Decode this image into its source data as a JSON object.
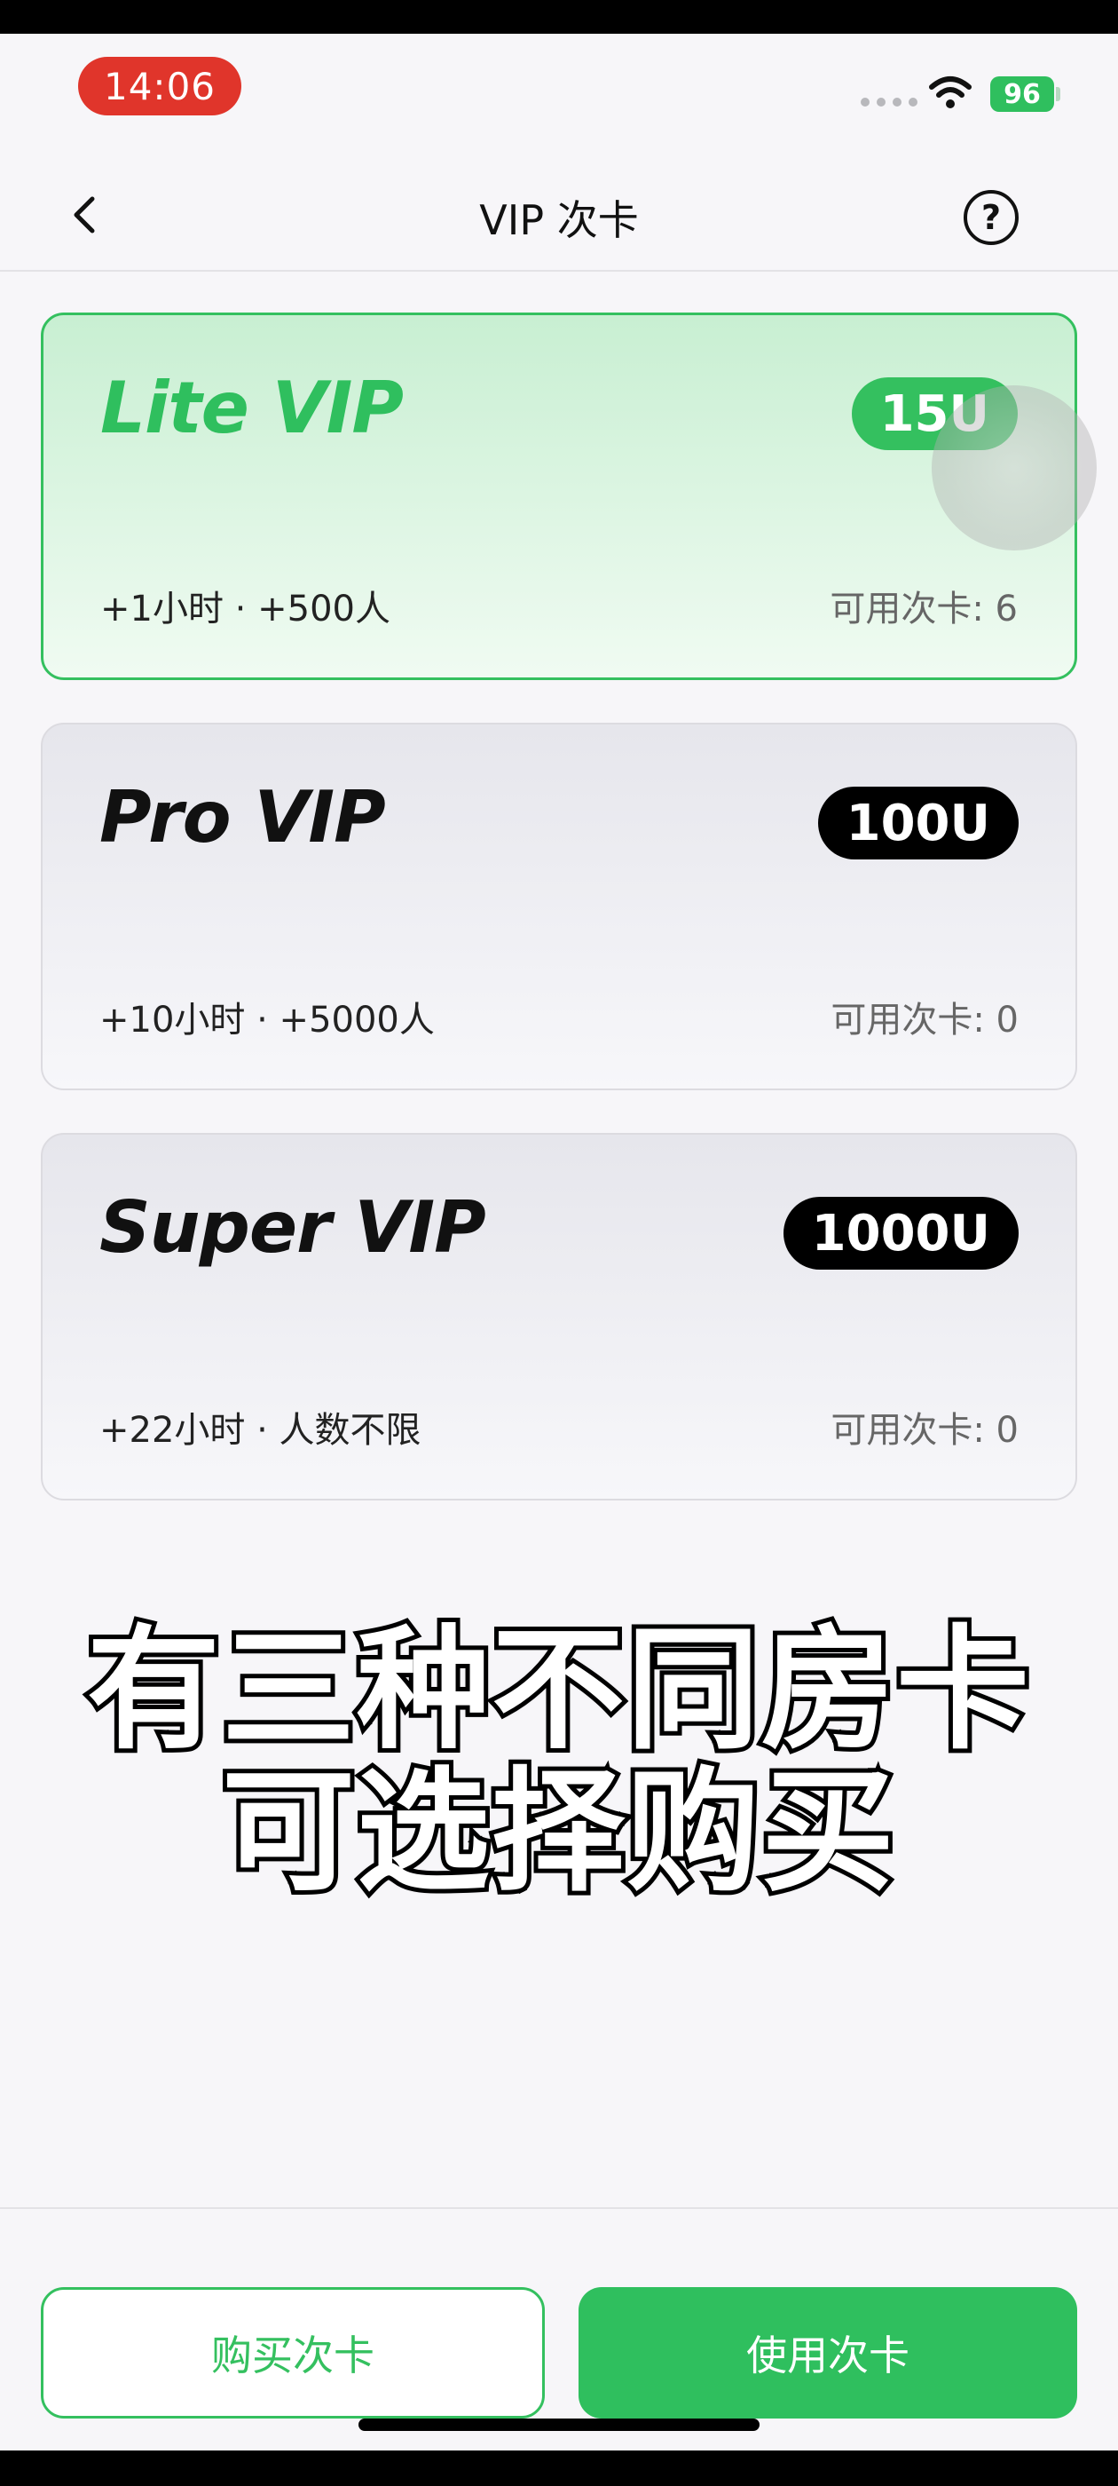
{
  "status_bar": {
    "time": "14:06",
    "battery": "96"
  },
  "nav": {
    "title": "VIP 次卡",
    "help_glyph": "?"
  },
  "cards": [
    {
      "name": "Lite VIP",
      "price": "15U",
      "desc": "+1小时 · +500人",
      "count": "可用次卡: 6",
      "selected": true
    },
    {
      "name": "Pro VIP",
      "price": "100U",
      "desc": "+10小时 · +5000人",
      "count": "可用次卡: 0",
      "selected": false
    },
    {
      "name": "Super VIP",
      "price": "1000U",
      "desc": "+22小时 · 人数不限",
      "count": "可用次卡: 0",
      "selected": false
    }
  ],
  "caption": {
    "line1": "有三种不同房卡",
    "line2": "可选择购买"
  },
  "buttons": {
    "buy": "购买次卡",
    "use": "使用次卡"
  },
  "colors": {
    "accent": "#2fbf5e",
    "status_time_bg": "#e0352b",
    "badge_dark": "#000000"
  }
}
